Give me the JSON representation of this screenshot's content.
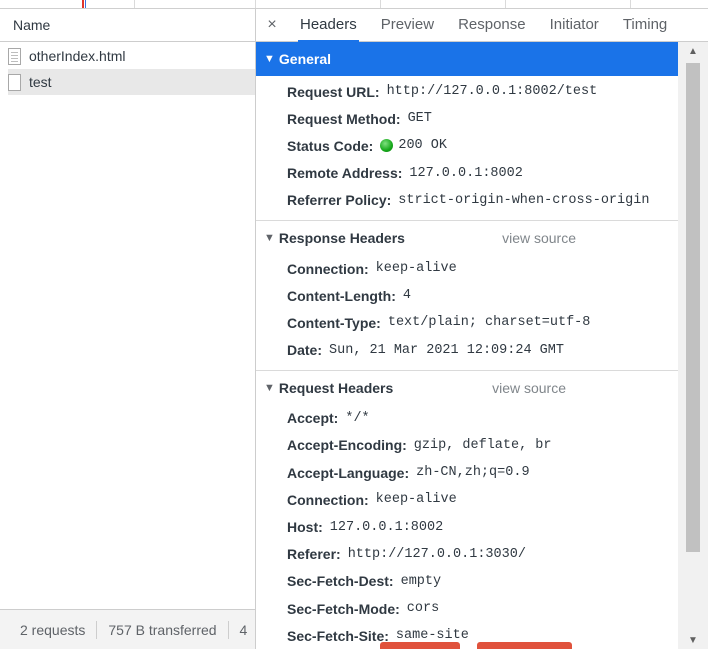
{
  "left": {
    "column_header": "Name",
    "files": [
      "otherIndex.html",
      "test"
    ],
    "footer": {
      "requests": "2 requests",
      "transferred": "757 B transferred",
      "more": "4"
    }
  },
  "tabs": {
    "close_glyph": "×",
    "items": [
      "Headers",
      "Preview",
      "Response",
      "Initiator",
      "Timing"
    ],
    "active": "Headers"
  },
  "general": {
    "title": "General",
    "rows": [
      {
        "key": "Request URL:",
        "value": "http://127.0.0.1:8002/test"
      },
      {
        "key": "Request Method:",
        "value": "GET"
      },
      {
        "key": "Status Code:",
        "value": "200 OK"
      },
      {
        "key": "Remote Address:",
        "value": "127.0.0.1:8002"
      },
      {
        "key": "Referrer Policy:",
        "value": "strict-origin-when-cross-origin"
      }
    ]
  },
  "response_headers": {
    "title": "Response Headers",
    "view_source": "view source",
    "rows": [
      {
        "key": "Connection:",
        "value": "keep-alive"
      },
      {
        "key": "Content-Length:",
        "value": "4"
      },
      {
        "key": "Content-Type:",
        "value": "text/plain; charset=utf-8"
      },
      {
        "key": "Date:",
        "value": "Sun, 21 Mar 2021 12:09:24 GMT"
      }
    ]
  },
  "request_headers": {
    "title": "Request Headers",
    "view_source": "view source",
    "rows": [
      {
        "key": "Accept:",
        "value": "*/*"
      },
      {
        "key": "Accept-Encoding:",
        "value": "gzip, deflate, br"
      },
      {
        "key": "Accept-Language:",
        "value": "zh-CN,zh;q=0.9"
      },
      {
        "key": "Connection:",
        "value": "keep-alive"
      },
      {
        "key": "Host:",
        "value": "127.0.0.1:8002"
      },
      {
        "key": "Referer:",
        "value": "http://127.0.0.1:3030/"
      },
      {
        "key": "Sec-Fetch-Dest:",
        "value": "empty"
      },
      {
        "key": "Sec-Fetch-Mode:",
        "value": "cors"
      },
      {
        "key": "Sec-Fetch-Site:",
        "value": "same-site"
      }
    ]
  },
  "icons": {
    "section_arrow": "collapse-arrow-icon",
    "status": "status-green-dot-icon",
    "file": "file-icon"
  },
  "colors": {
    "accent": "#1a73e8",
    "status_ok": "#16a81a"
  }
}
